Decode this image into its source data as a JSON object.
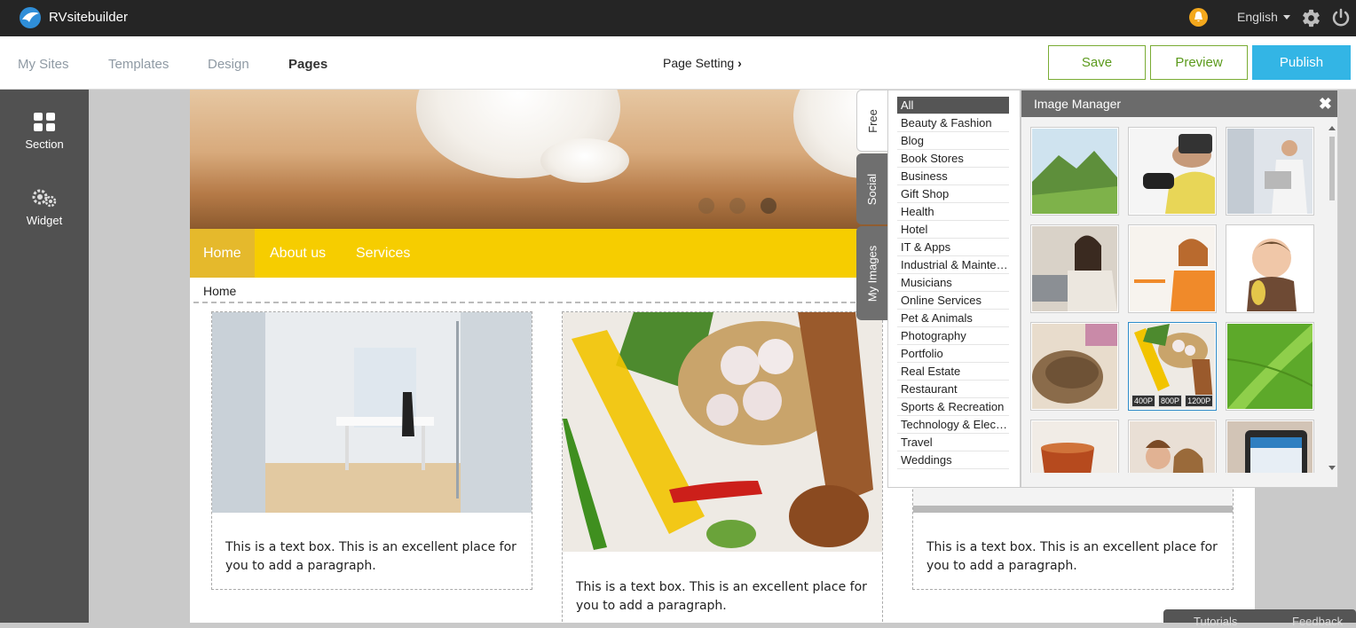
{
  "topbar": {
    "app_name": "RVsitebuilder",
    "language": "English",
    "icons": [
      "logo-icon",
      "bell-icon",
      "gear-icon",
      "power-icon"
    ],
    "colors": {
      "background": "#252525",
      "bell": "#f3a81d"
    }
  },
  "nav": {
    "tabs": [
      {
        "label": "My Sites",
        "active": false
      },
      {
        "label": "Templates",
        "active": false
      },
      {
        "label": "Design",
        "active": false
      },
      {
        "label": "Pages",
        "active": true
      }
    ],
    "page_setting": "Page Setting",
    "buttons": {
      "save": "Save",
      "preview": "Preview",
      "publish": "Publish"
    },
    "colors": {
      "save_border": "#7aac34",
      "publish": "#33b5e5"
    }
  },
  "sidebar": {
    "items": [
      {
        "label": "Section",
        "icon": "grid-icon"
      },
      {
        "label": "Widget",
        "icon": "gears-icon"
      }
    ]
  },
  "site": {
    "menu": {
      "items": [
        "Home",
        "About us",
        "Services"
      ],
      "active": "Home",
      "color": "#f6cd00"
    },
    "breadcrumb": "Home",
    "cards": [
      {
        "text": "This is a text box. This is an excellent place for you to add a paragraph."
      },
      {
        "text": "This is a text box. This is an excellent place for you to add a paragraph."
      },
      {
        "text": "This is a text box. This is an excellent place for you to add a paragraph."
      }
    ]
  },
  "image_manager": {
    "title": "Image Manager",
    "close": "✖",
    "tabs": [
      "Free",
      "Social",
      "My Images"
    ],
    "active_tab": "Free",
    "categories": [
      "All",
      "Beauty & Fashion",
      "Blog",
      "Book Stores",
      "Business",
      "Gift Shop",
      "Health",
      "Hotel",
      "IT & Apps",
      "Industrial & Maintenance",
      "Musicians",
      "Online Services",
      "Pet & Animals",
      "Photography",
      "Portfolio",
      "Real Estate",
      "Restaurant",
      "Sports & Recreation",
      "Technology & Electronics",
      "Travel",
      "Weddings"
    ],
    "selected_category": "All",
    "size_options": [
      "400P",
      "800P",
      "1200P"
    ]
  },
  "footer": {
    "help": [
      "Tutorials",
      "Feedback"
    ]
  }
}
